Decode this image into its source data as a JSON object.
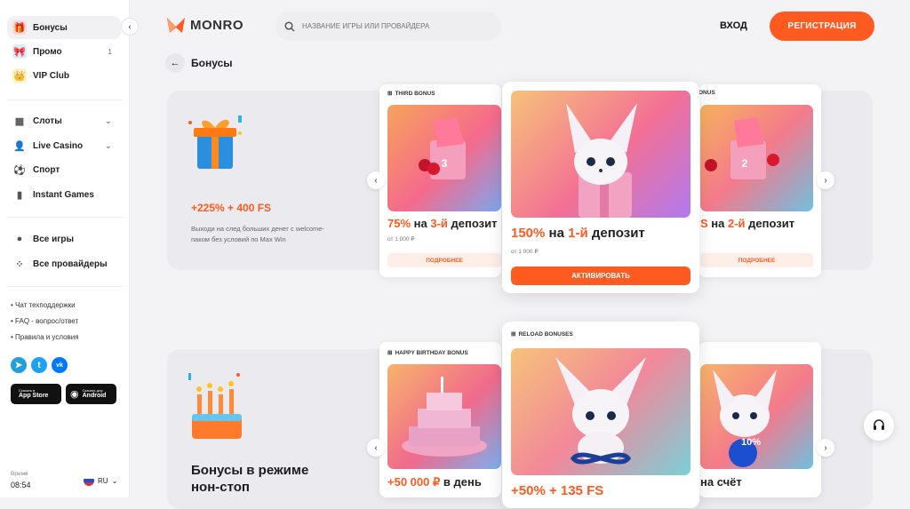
{
  "brand": {
    "name": "MONRO"
  },
  "search": {
    "placeholder": "НАЗВАНИЕ ИГРЫ ИЛИ ПРОВАЙДЕРА"
  },
  "header": {
    "login": "ВХОД",
    "register": "РЕГИСТРАЦИЯ"
  },
  "sidebar": {
    "top": [
      {
        "label": "Бонусы",
        "icon": "gift-icon",
        "active": true
      },
      {
        "label": "Промо",
        "icon": "promo-icon",
        "badge": "1"
      },
      {
        "label": "VIP Club",
        "icon": "crown-icon"
      }
    ],
    "games": [
      {
        "label": "Слоты",
        "icon": "slots-icon"
      },
      {
        "label": "Live Casino",
        "icon": "live-casino-icon"
      },
      {
        "label": "Спорт",
        "icon": "ball-icon"
      },
      {
        "label": "Instant Games",
        "icon": "bar-chart-icon"
      }
    ],
    "catalog": [
      {
        "label": "Все игры",
        "icon": "all-games-icon"
      },
      {
        "label": "Все провайдеры",
        "icon": "providers-icon"
      }
    ],
    "links": [
      "Чат техподдержки",
      "FAQ - вопрос/ответ",
      "Правила и условия"
    ],
    "stores": [
      {
        "line1": "Скачать в",
        "line2": "App Store"
      },
      {
        "line1": "Скачать для",
        "line2": "Android"
      }
    ],
    "time_label": "Время",
    "time": "08:54",
    "lang": "RU"
  },
  "page": {
    "title": "Бонусы"
  },
  "welcome": {
    "offer": "+225% + 400 FS",
    "description": "Выходи на след больших денег с welcome-паком без условий по Max Win",
    "cards": [
      {
        "tag": "THIRD BONUS",
        "pct": "75%",
        "text": "на 3-й депозит",
        "hl": "3-й",
        "min": "от 1 000 ₽",
        "button": "ПОДРОБНЕЕ"
      },
      {
        "tag": "",
        "pct": "150%",
        "text": "на 1-й депозит",
        "hl": "1-й",
        "min": "от 1 000 ₽",
        "button": "АКТИВИРОВАТЬ"
      },
      {
        "tag": "ONUS",
        "pct": "S",
        "text": "на 2-й депозит",
        "hl": "2-й",
        "min": "",
        "button": "ПОДРОБНЕЕ"
      }
    ]
  },
  "reload": {
    "title": "Бонусы в режиме нон-стоп",
    "cards": [
      {
        "tag": "HAPPY BIRTHDAY BONUS",
        "title": "+50 000 ₽ в день"
      },
      {
        "tag": "RELOAD BONUSES",
        "title": "+50% + 135 FS"
      },
      {
        "tag": "",
        "title": "на счёт",
        "badge": "10%"
      }
    ]
  },
  "colors": {
    "accent": "#ff5a1f"
  }
}
